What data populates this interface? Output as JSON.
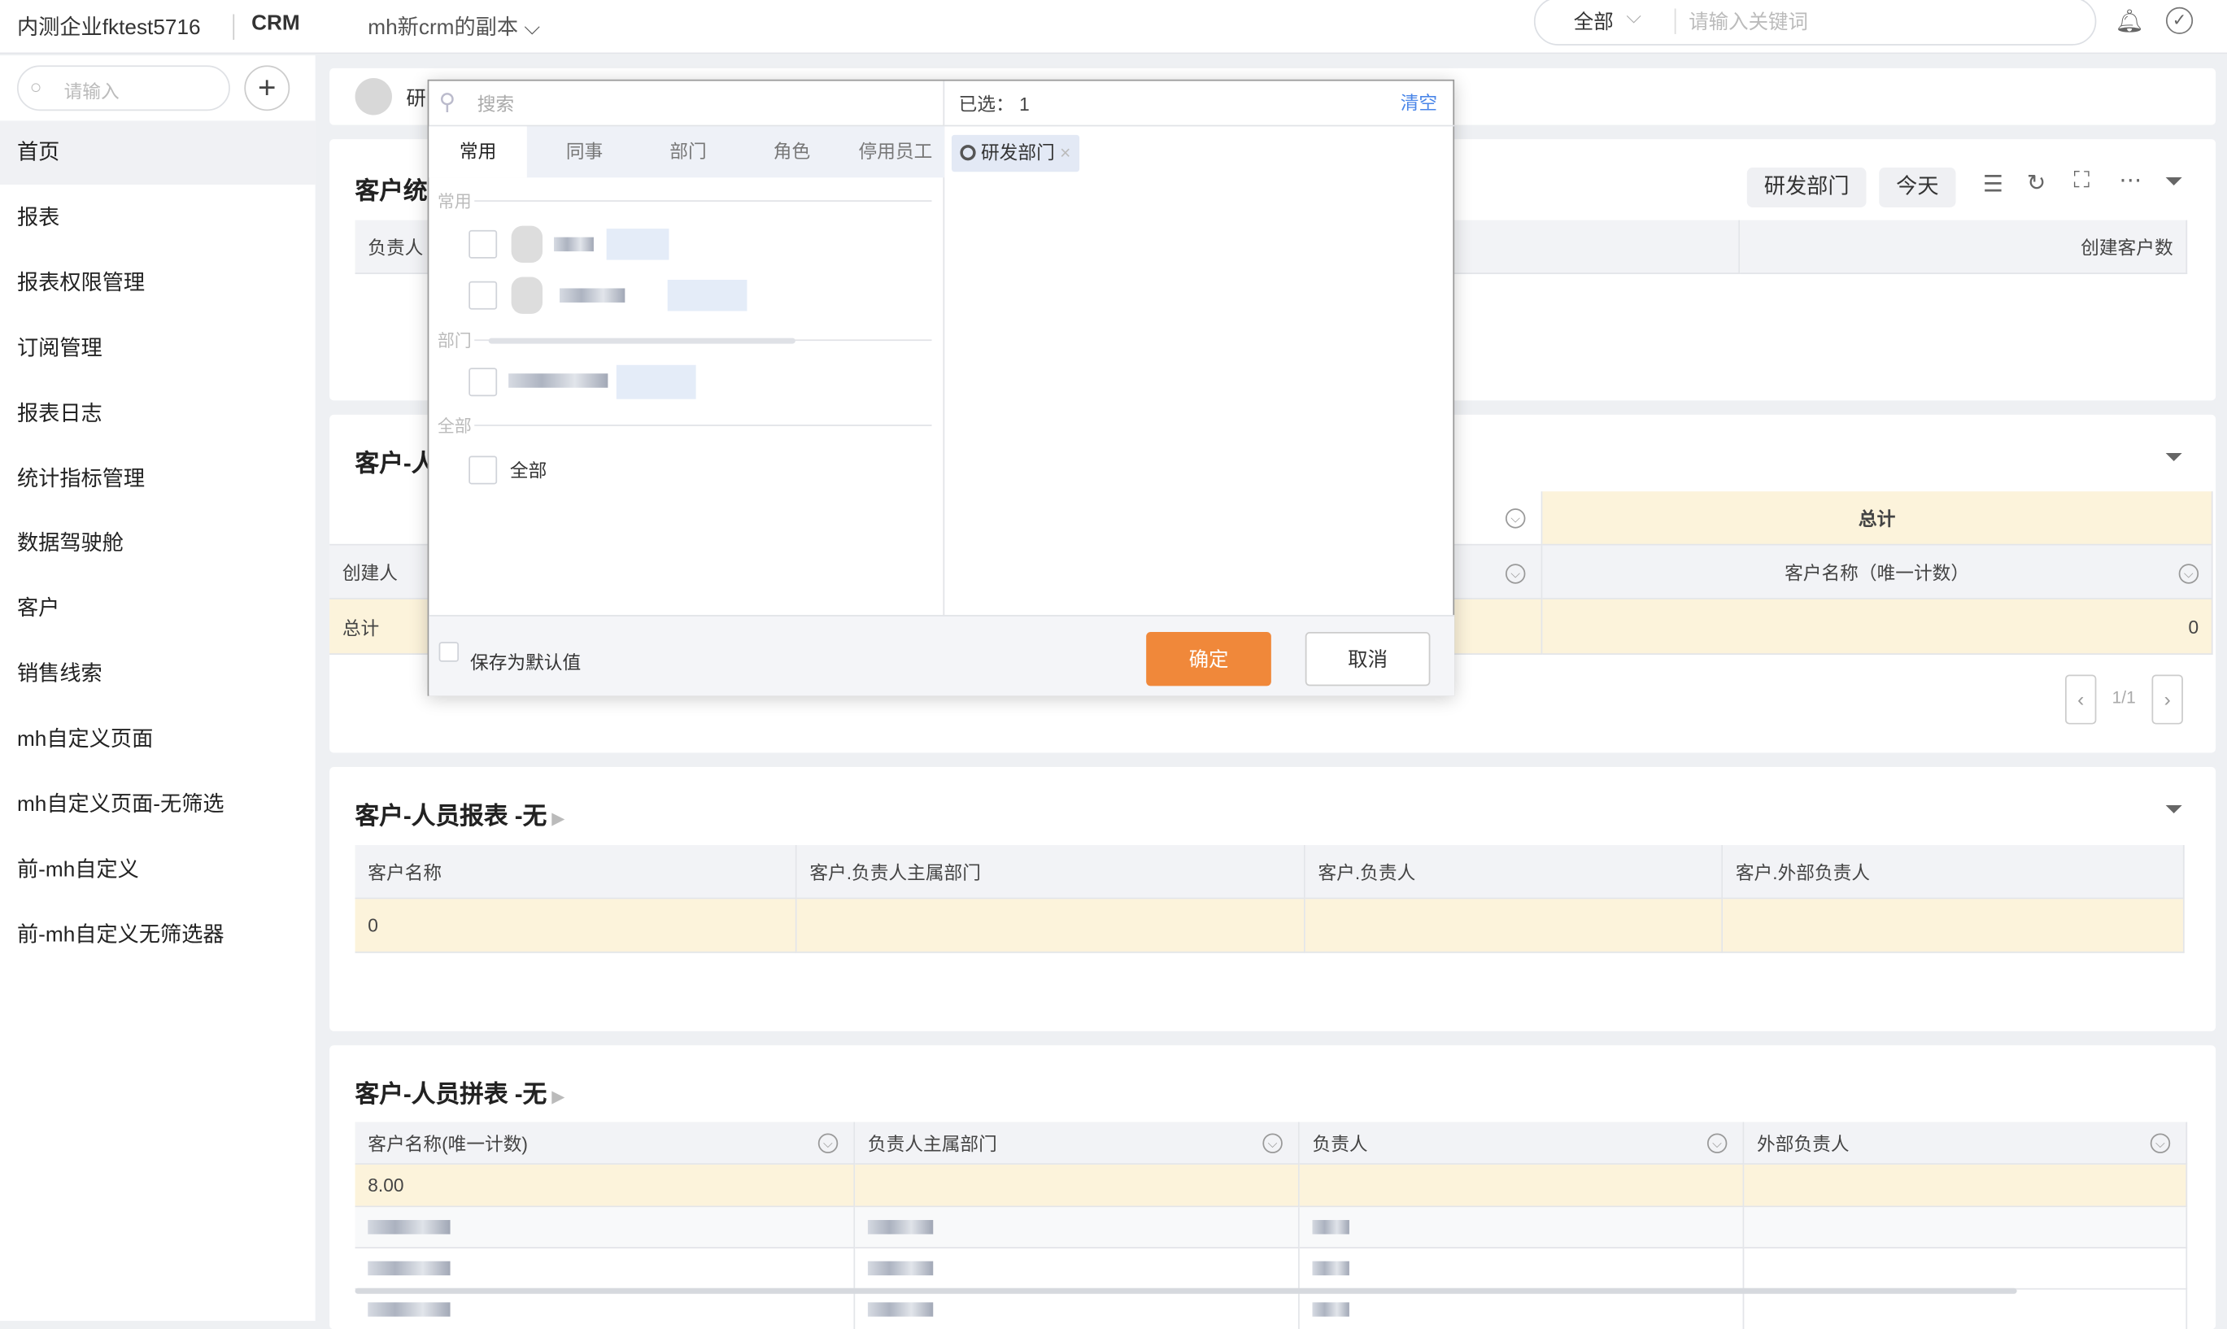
{
  "header": {
    "company": "内测企业fktest5716",
    "app": "CRM",
    "workspace": "mh新crm的副本",
    "scope": "全部",
    "search_placeholder": "请输入关键词"
  },
  "sidebar": {
    "search_placeholder": "请输入",
    "items": [
      {
        "label": "首页"
      },
      {
        "label": "报表"
      },
      {
        "label": "报表权限管理"
      },
      {
        "label": "订阅管理"
      },
      {
        "label": "报表日志"
      },
      {
        "label": "统计指标管理"
      },
      {
        "label": "数据驾驶舱"
      },
      {
        "label": "客户"
      },
      {
        "label": "销售线索"
      },
      {
        "label": "mh自定义页面"
      },
      {
        "label": "mh自定义页面-无筛选"
      },
      {
        "label": "前-mh自定义"
      },
      {
        "label": "前-mh自定义无筛选器"
      }
    ]
  },
  "filter_bar": {
    "label": "研"
  },
  "card1": {
    "title": "客户统",
    "dept_chip": "研发部门",
    "date_chip": "今天",
    "col_owner": "负责人",
    "col_created": "创建客户数"
  },
  "card2": {
    "title": "客户-人",
    "total_header": "总计",
    "row_creator": "创建人",
    "col_customer": "客户名称（唯一计数）",
    "row_total": "总计",
    "total_value": "0",
    "pagination": "1/1"
  },
  "card3": {
    "title": "客户-人员报表 -无",
    "columns": [
      "客户名称",
      "客户.负责人主属部门",
      "客户.负责人",
      "客户.外部负责人"
    ],
    "row": [
      "0",
      "",
      "",
      ""
    ]
  },
  "card4": {
    "title": "客户-人员拼表 -无",
    "columns": [
      "客户名称(唯一计数)",
      "负责人主属部门",
      "负责人",
      "外部负责人"
    ],
    "summary": [
      "8.00",
      "",
      "",
      ""
    ]
  },
  "modal": {
    "search_placeholder": "搜索",
    "selected_label": "已选：",
    "selected_count": "1",
    "clear": "清空",
    "tabs": [
      "常用",
      "同事",
      "部门",
      "角色",
      "停用员工"
    ],
    "sections": {
      "common": "常用",
      "dept": "部门",
      "all": "全部"
    },
    "all_option": "全部",
    "selected_tag": "研发部门",
    "save_default": "保存为默认值",
    "confirm": "确定",
    "cancel": "取消",
    "accent": "#f0883a",
    "link": "#4a86e8"
  }
}
